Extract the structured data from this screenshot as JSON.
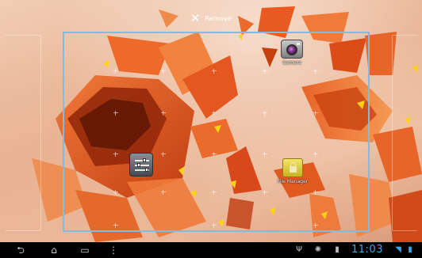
{
  "remove_bar": {
    "icon": "close-x-icon",
    "label": "Remove"
  },
  "workspace": {
    "apps": [
      {
        "name": "camera",
        "label": "Camera",
        "icon": "camera-icon"
      },
      {
        "name": "settings",
        "label": "",
        "icon": "settings-sliders-icon"
      },
      {
        "name": "file-manager",
        "label": "File Manager",
        "icon": "folder-lock-icon"
      }
    ]
  },
  "navbar": {
    "buttons": [
      {
        "name": "back",
        "icon": "back-arrow-icon"
      },
      {
        "name": "home",
        "icon": "home-icon"
      },
      {
        "name": "recent-apps",
        "icon": "recent-apps-icon"
      },
      {
        "name": "menu",
        "icon": "menu-dots-icon"
      }
    ],
    "status_icons": [
      "usb-icon",
      "debug-icon",
      "sdcard-icon",
      "wifi-icon",
      "battery-icon"
    ],
    "clock": "11:03"
  },
  "colors": {
    "accent": "#3aa8e6",
    "frame": "#7fbde0",
    "wallpaper_accent": "#e2561e"
  }
}
